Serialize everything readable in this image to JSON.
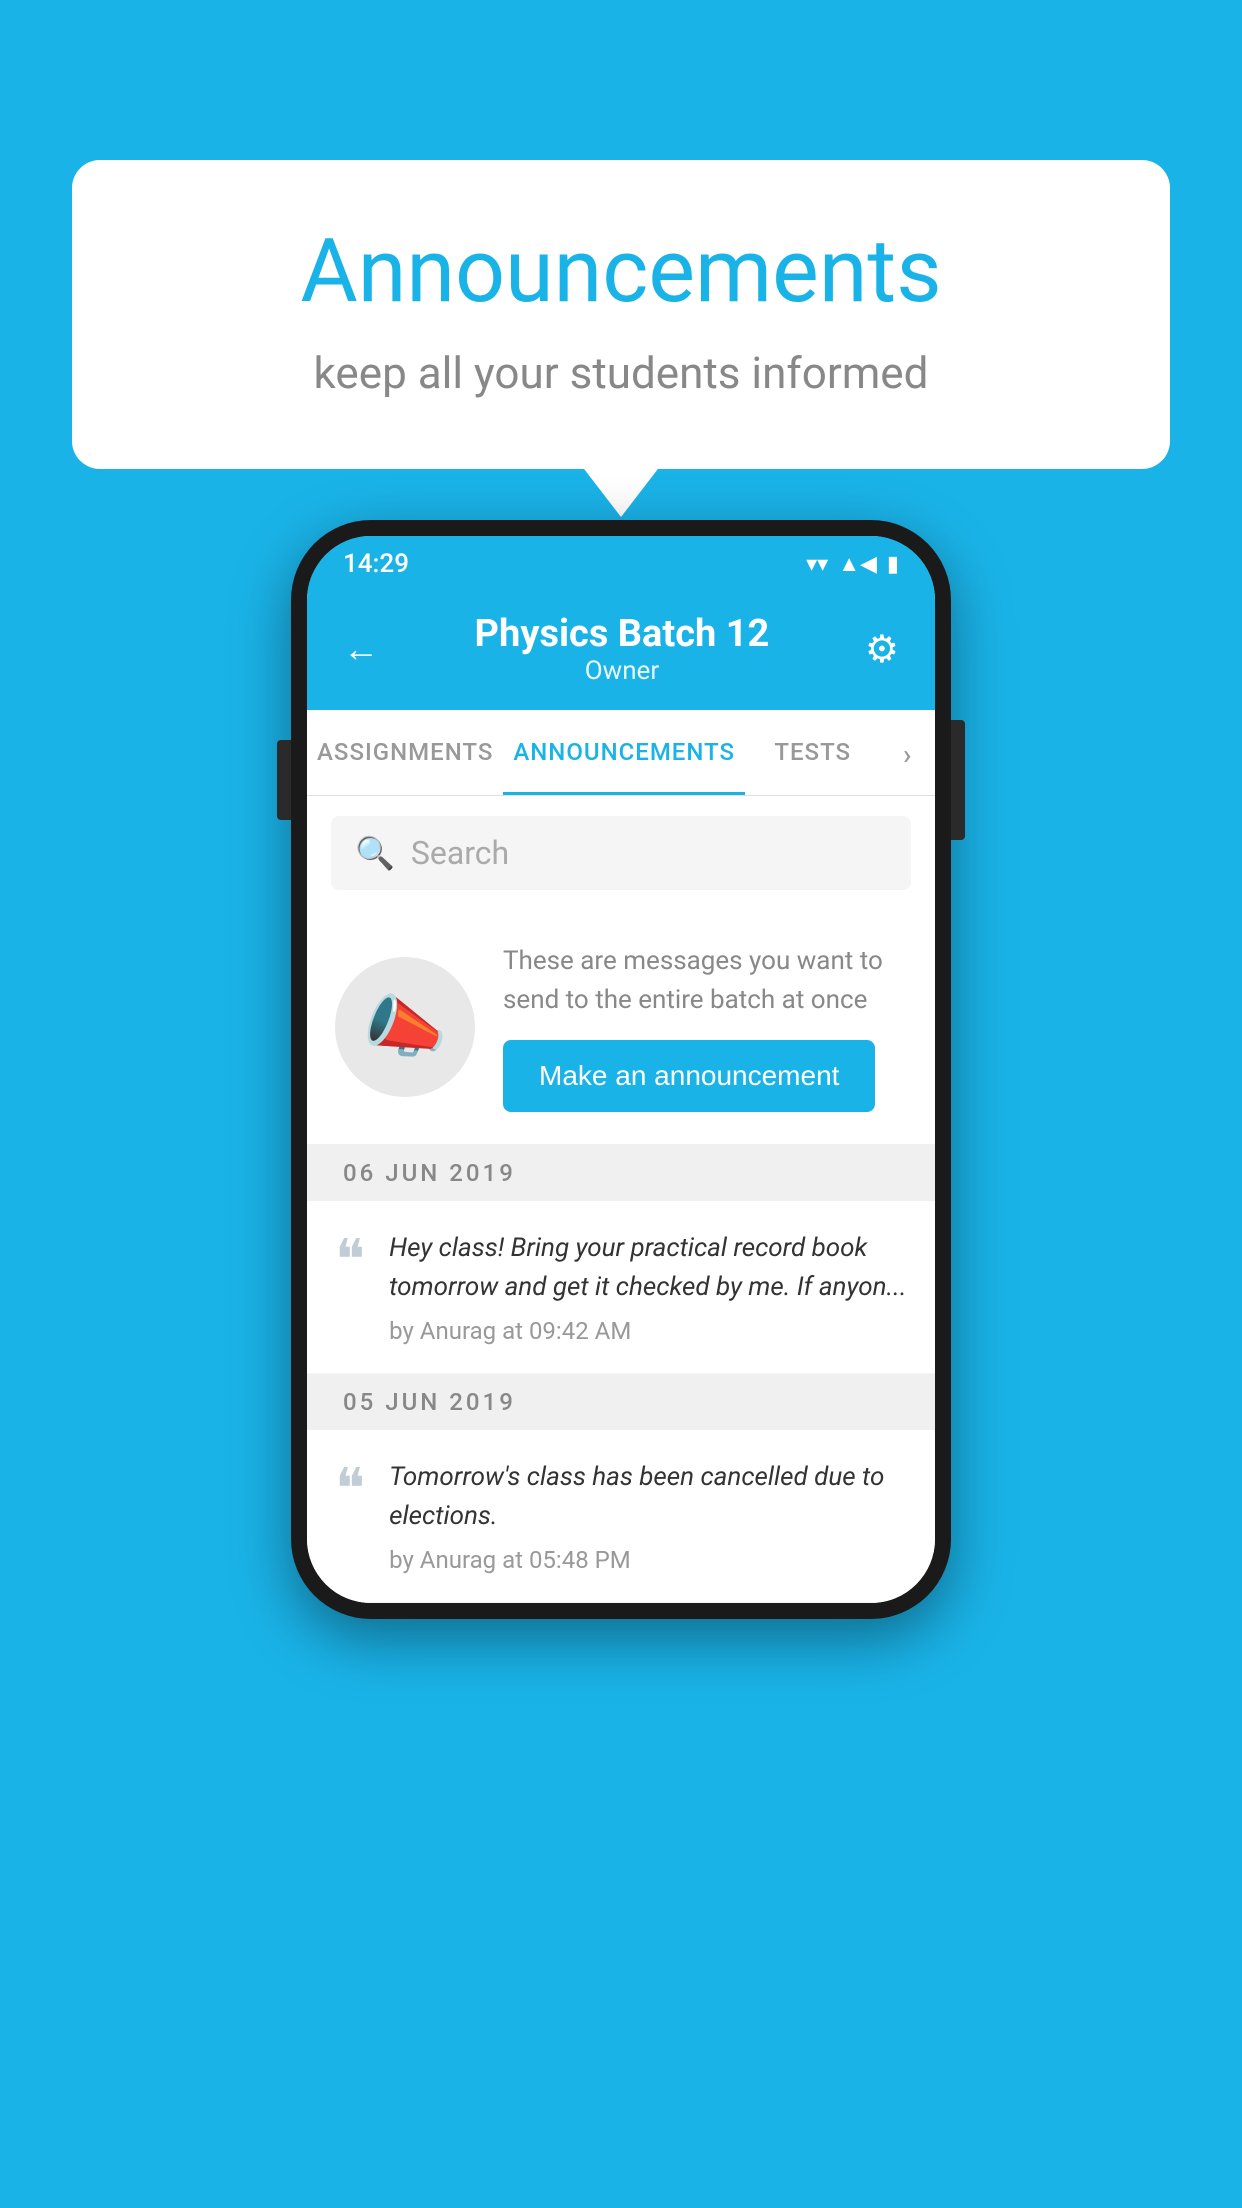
{
  "background_color": "#1ab3e8",
  "speech_bubble": {
    "title": "Announcements",
    "subtitle": "keep all your students informed"
  },
  "status_bar": {
    "time": "14:29",
    "wifi": "▼",
    "signal": "▲",
    "battery": "▉"
  },
  "header": {
    "title": "Physics Batch 12",
    "subtitle": "Owner",
    "back_label": "←",
    "settings_label": "⚙"
  },
  "tabs": [
    {
      "label": "ASSIGNMENTS",
      "active": false
    },
    {
      "label": "ANNOUNCEMENTS",
      "active": true
    },
    {
      "label": "TESTS",
      "active": false
    },
    {
      "label": "›",
      "active": false
    }
  ],
  "search": {
    "placeholder": "Search"
  },
  "announcement_prompt": {
    "description": "These are messages you want to send to the entire batch at once",
    "button_label": "Make an announcement"
  },
  "announcements": [
    {
      "date": "06  JUN  2019",
      "text": "Hey class! Bring your practical record book tomorrow and get it checked by me. If anyon...",
      "meta": "by Anurag at 09:42 AM"
    },
    {
      "date": "05  JUN  2019",
      "text": "Tomorrow's class has been cancelled due to elections.",
      "meta": "by Anurag at 05:48 PM"
    }
  ]
}
